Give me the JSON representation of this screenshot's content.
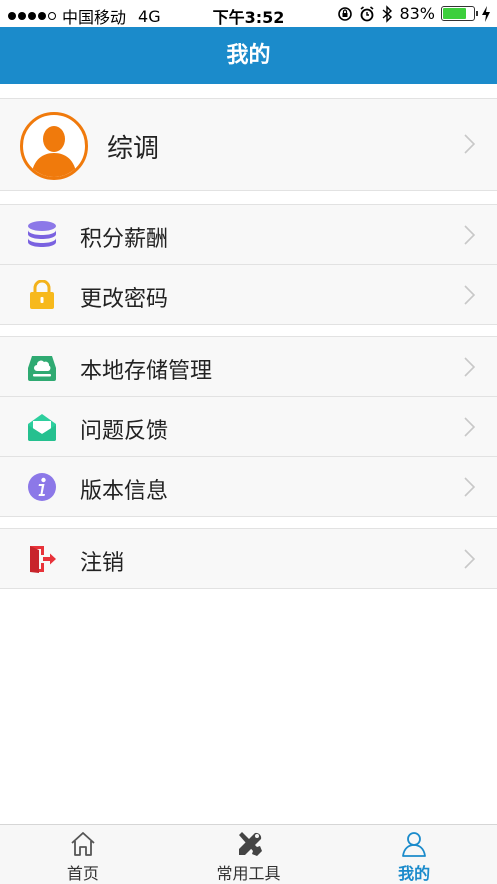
{
  "status_bar": {
    "carrier": "中国移动",
    "network": "4G",
    "time": "下午3:52",
    "battery_text": "83%",
    "battery_level": 0.83
  },
  "header": {
    "title": "我的"
  },
  "profile": {
    "name": "综调"
  },
  "menu_groups": [
    {
      "items": [
        {
          "label": "积分薪酬",
          "icon": "coins-stack-icon"
        },
        {
          "label": "更改密码",
          "icon": "lock-icon"
        }
      ]
    },
    {
      "items": [
        {
          "label": "本地存储管理",
          "icon": "storage-icon"
        },
        {
          "label": "问题反馈",
          "icon": "envelope-icon"
        },
        {
          "label": "版本信息",
          "icon": "info-icon"
        }
      ]
    },
    {
      "items": [
        {
          "label": "注销",
          "icon": "logout-icon"
        }
      ]
    }
  ],
  "tabs": [
    {
      "label": "首页",
      "icon": "home-icon",
      "active": false
    },
    {
      "label": "常用工具",
      "icon": "tools-icon",
      "active": false
    },
    {
      "label": "我的",
      "icon": "user-icon",
      "active": true
    }
  ],
  "colors": {
    "header_bg": "#1b8bcb",
    "active_tab": "#1b8bcb",
    "avatar_accent": "#f07a0c",
    "logout_red": "#e8333a"
  }
}
